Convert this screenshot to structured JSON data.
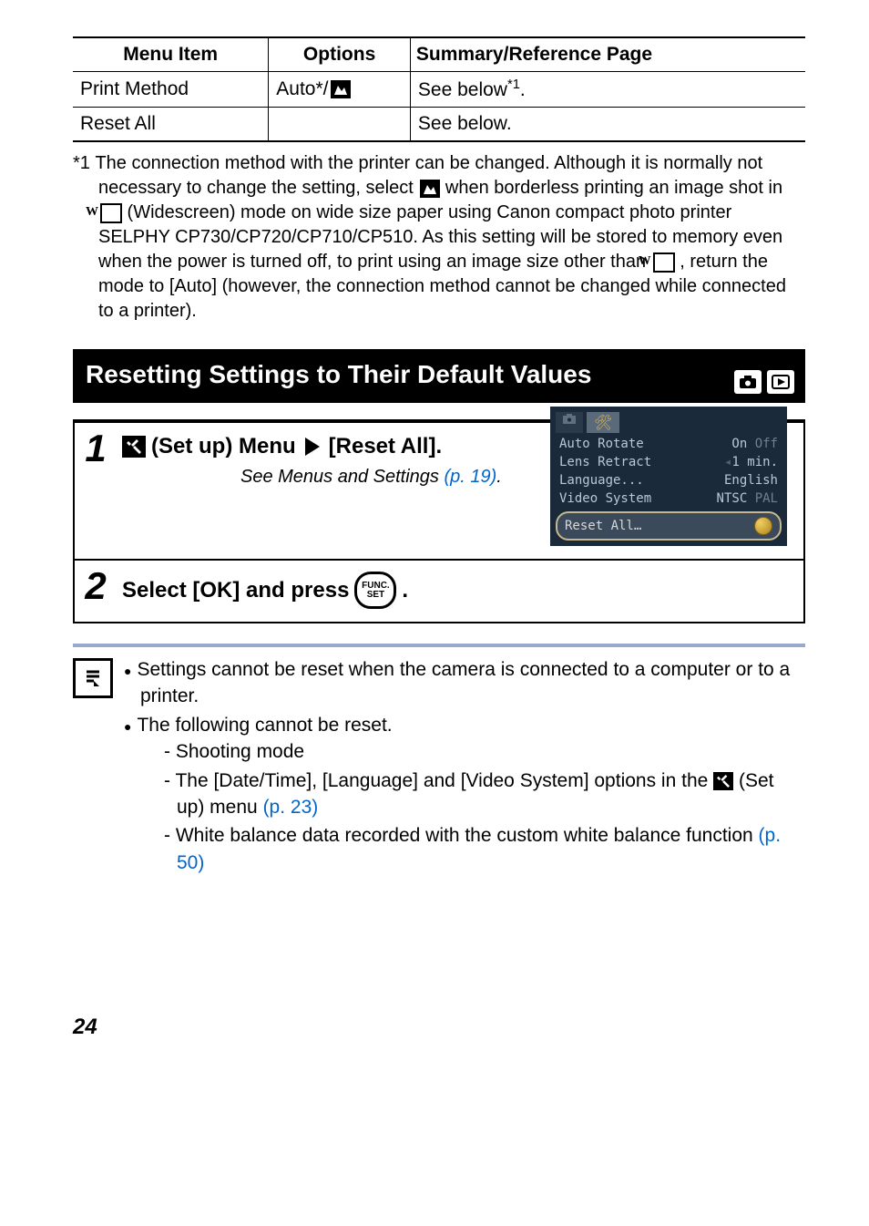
{
  "table": {
    "headers": {
      "menu": "Menu Item",
      "options": "Options",
      "summary": "Summary/Reference Page"
    },
    "rows": [
      {
        "menu": "Print Method",
        "option_prefix": "Auto*/",
        "summary_prefix": "See below",
        "summary_sup": "*1",
        "summary_suffix": "."
      },
      {
        "menu": "Reset All",
        "option_prefix": "",
        "summary_prefix": "See below.",
        "summary_sup": "",
        "summary_suffix": ""
      }
    ]
  },
  "footnote": {
    "marker": "*1",
    "text_a": "The connection method with the printer can be changed. Although it is normally not necessary to change the setting, select ",
    "text_b": " when borderless printing an image shot in ",
    "text_c": " (Widescreen) mode on wide size paper using Canon compact photo printer SELPHY CP730/CP720/CP710/CP510. As this setting will be stored to memory even when the power is turned off, to print using an image size other than ",
    "text_d": " , return the mode to [Auto] (however, the connection method cannot be changed while connected to a printer)."
  },
  "heading": "Resetting Settings to Their Default Values",
  "steps": [
    {
      "num": "1",
      "title_a": "(Set up) Menu",
      "title_b": "[Reset All].",
      "see_text": "See Menus and Settings ",
      "see_link": "(p. 19)",
      "see_period": "."
    },
    {
      "num": "2",
      "title_full_a": "Select [OK] and press ",
      "title_full_b": "."
    }
  ],
  "menu_shot": {
    "items": [
      {
        "label": "Auto Rotate",
        "on": "On",
        "off": "Off"
      },
      {
        "label": "Lens Retract",
        "on": "1 min.",
        "off": ""
      },
      {
        "label": "Language...",
        "on": "English",
        "off": ""
      },
      {
        "label": "Video System",
        "on": "NTSC",
        "off": "PAL"
      }
    ],
    "reset": "Reset All…"
  },
  "func_btn": {
    "top": "FUNC.",
    "bottom": "SET"
  },
  "notes": {
    "b1": "Settings cannot be reset when the camera is connected to a computer or to a printer.",
    "b2": "The following cannot be reset.",
    "s1": "Shooting mode",
    "s2a": "The [Date/Time], [Language] and [Video System] options in the ",
    "s2b": " (Set up) menu ",
    "s2link": "(p. 23)",
    "s3a": "White balance data recorded with the custom white balance function ",
    "s3link": "(p. 50)"
  },
  "page_number": "24"
}
